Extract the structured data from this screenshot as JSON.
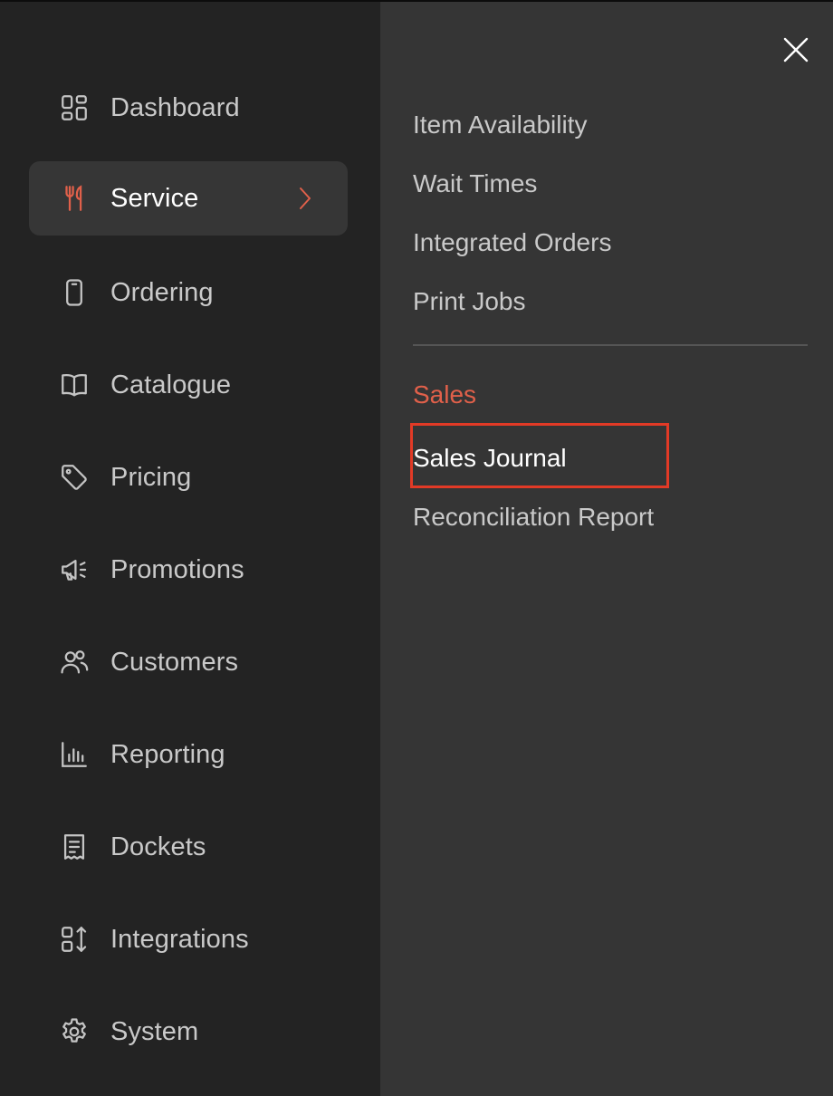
{
  "sidebar": {
    "items": [
      {
        "label": "Dashboard",
        "icon": "dashboard-icon"
      },
      {
        "label": "Service",
        "icon": "utensils-icon",
        "active": true
      },
      {
        "label": "Ordering",
        "icon": "phone-icon"
      },
      {
        "label": "Catalogue",
        "icon": "book-icon"
      },
      {
        "label": "Pricing",
        "icon": "tag-icon"
      },
      {
        "label": "Promotions",
        "icon": "megaphone-icon"
      },
      {
        "label": "Customers",
        "icon": "users-icon"
      },
      {
        "label": "Reporting",
        "icon": "bar-chart-icon"
      },
      {
        "label": "Dockets",
        "icon": "receipt-icon"
      },
      {
        "label": "Integrations",
        "icon": "integrations-icon"
      },
      {
        "label": "System",
        "icon": "gear-icon"
      }
    ]
  },
  "submenu": {
    "links": [
      "Item Availability",
      "Wait Times",
      "Integrated Orders",
      "Print Jobs"
    ],
    "sales_heading": "Sales",
    "sales_links": [
      "Sales Journal",
      "Reconciliation Report"
    ]
  },
  "colors": {
    "accent": "#e0604a",
    "highlight": "#e23a26",
    "sidebar_bg": "#232323",
    "panel_bg": "#353535"
  }
}
